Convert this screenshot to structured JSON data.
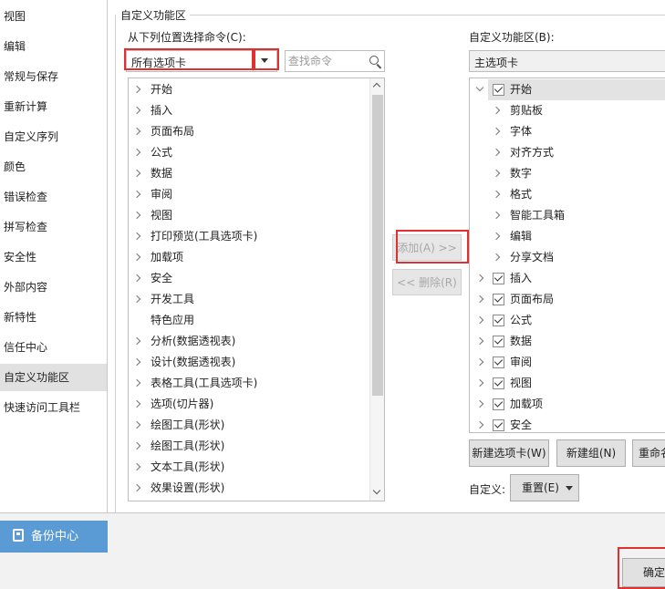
{
  "sidebar": {
    "items": [
      {
        "label": "视图"
      },
      {
        "label": "编辑"
      },
      {
        "label": "常规与保存"
      },
      {
        "label": "重新计算"
      },
      {
        "label": "自定义序列"
      },
      {
        "label": "颜色"
      },
      {
        "label": "错误检查"
      },
      {
        "label": "拼写检查"
      },
      {
        "label": "安全性"
      },
      {
        "label": "外部内容"
      },
      {
        "label": "新特性"
      },
      {
        "label": "信任中心"
      },
      {
        "label": "自定义功能区",
        "selected": true
      },
      {
        "label": "快速访问工具栏"
      }
    ],
    "backup_label": "备份中心"
  },
  "panel": {
    "group_title": "自定义功能区",
    "left_label": "从下列位置选择命令(C):",
    "left_dropdown_value": "所有选项卡",
    "search_placeholder": "查找命令",
    "right_label": "自定义功能区(B):",
    "right_dropdown_value": "主选项卡",
    "add_button": "添加(A) >>",
    "remove_button": "<< 删除(R)",
    "new_tab_button": "新建选项卡(W)",
    "new_group_button": "新建组(N)",
    "rename_button": "重命名",
    "customize_label": "自定义:",
    "reset_button": "重置(E)",
    "ok_button": "确定"
  },
  "left_list": [
    {
      "label": "开始",
      "expander": true
    },
    {
      "label": "插入",
      "expander": true
    },
    {
      "label": "页面布局",
      "expander": true
    },
    {
      "label": "公式",
      "expander": true
    },
    {
      "label": "数据",
      "expander": true
    },
    {
      "label": "审阅",
      "expander": true
    },
    {
      "label": "视图",
      "expander": true
    },
    {
      "label": "打印预览(工具选项卡)",
      "expander": true
    },
    {
      "label": "加载项",
      "expander": true
    },
    {
      "label": "安全",
      "expander": true
    },
    {
      "label": "开发工具",
      "expander": true
    },
    {
      "label": "特色应用",
      "expander": false
    },
    {
      "label": "分析(数据透视表)",
      "expander": true
    },
    {
      "label": "设计(数据透视表)",
      "expander": true
    },
    {
      "label": "表格工具(工具选项卡)",
      "expander": true
    },
    {
      "label": "选项(切片器)",
      "expander": true
    },
    {
      "label": "绘图工具(形状)",
      "expander": true
    },
    {
      "label": "绘图工具(形状)",
      "expander": true
    },
    {
      "label": "文本工具(形状)",
      "expander": true
    },
    {
      "label": "效果设置(形状)",
      "expander": true
    }
  ],
  "right_list": [
    {
      "label": "开始",
      "level": 0,
      "expanded": true,
      "checkbox": true,
      "selected": true
    },
    {
      "label": "剪贴板",
      "level": 1,
      "checkbox": false
    },
    {
      "label": "字体",
      "level": 1,
      "checkbox": false
    },
    {
      "label": "对齐方式",
      "level": 1,
      "checkbox": false
    },
    {
      "label": "数字",
      "level": 1,
      "checkbox": false
    },
    {
      "label": "格式",
      "level": 1,
      "checkbox": false
    },
    {
      "label": "智能工具箱",
      "level": 1,
      "checkbox": false
    },
    {
      "label": "编辑",
      "level": 1,
      "checkbox": false
    },
    {
      "label": "分享文档",
      "level": 1,
      "checkbox": false
    },
    {
      "label": "插入",
      "level": 0,
      "checkbox": true
    },
    {
      "label": "页面布局",
      "level": 0,
      "checkbox": true
    },
    {
      "label": "公式",
      "level": 0,
      "checkbox": true
    },
    {
      "label": "数据",
      "level": 0,
      "checkbox": true
    },
    {
      "label": "审阅",
      "level": 0,
      "checkbox": true
    },
    {
      "label": "视图",
      "level": 0,
      "checkbox": true
    },
    {
      "label": "加载项",
      "level": 0,
      "checkbox": true
    },
    {
      "label": "安全",
      "level": 0,
      "checkbox": true
    }
  ],
  "colors": {
    "accent": "#5b9bd5",
    "highlight": "#e03030"
  }
}
